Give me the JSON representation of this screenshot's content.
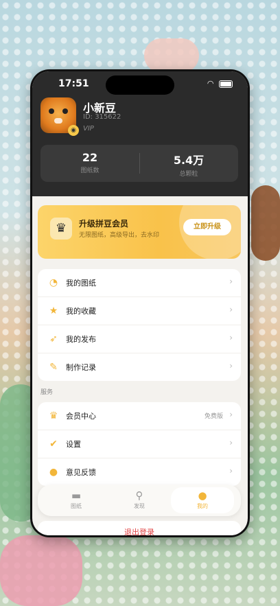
{
  "status_bar": {
    "time": "17:51"
  },
  "profile": {
    "name": "小新豆",
    "id_text": "ID: 315622",
    "badge": "VIP"
  },
  "stats": [
    {
      "value": "22",
      "label": "图纸数"
    },
    {
      "value": "5.4万",
      "label": "总颗粒"
    }
  ],
  "vip_card": {
    "title": "升级拼豆会员",
    "subtitle": "无限图纸，高级导出，去水印",
    "button": "立即升级"
  },
  "menu_main": [
    {
      "label": "我的图纸",
      "icon": "drawings-icon"
    },
    {
      "label": "我的收藏",
      "icon": "star-icon"
    },
    {
      "label": "我的发布",
      "icon": "rocket-icon"
    },
    {
      "label": "制作记录",
      "icon": "pencil-icon"
    }
  ],
  "services": {
    "title": "服务",
    "items": [
      {
        "label": "会员中心",
        "icon": "crown-icon",
        "extra": "免费版"
      },
      {
        "label": "设置",
        "icon": "settings-check-icon"
      },
      {
        "label": "意见反馈",
        "icon": "chat-icon"
      }
    ]
  },
  "tabs": [
    {
      "label": "图纸",
      "icon": "folder-icon",
      "active": false
    },
    {
      "label": "发现",
      "icon": "search-icon",
      "active": false
    },
    {
      "label": "我的",
      "icon": "person-icon",
      "active": true
    }
  ],
  "logout": "退出登录",
  "colors": {
    "accent": "#f2b63a",
    "dark_header": "#2b2b2b",
    "danger": "#e04040"
  }
}
